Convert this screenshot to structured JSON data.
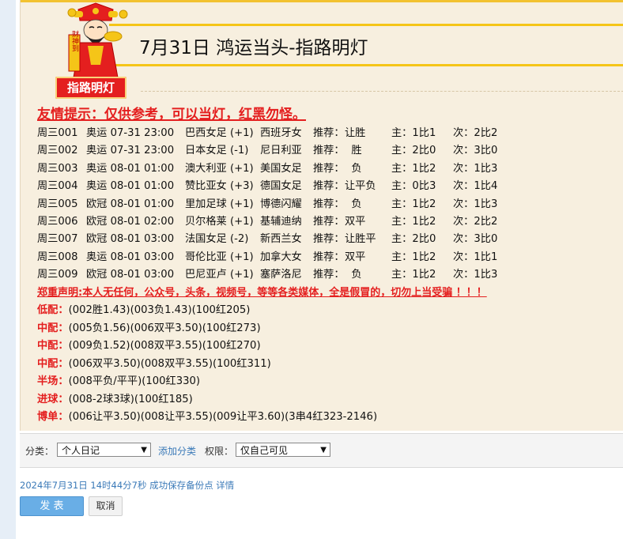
{
  "post": {
    "title": "7月31日 鸿运当头-指路明灯",
    "banner": "指路明灯",
    "mascot_label": "财神到",
    "tip": "友情提示：仅供参考，可以当灯，红黑勿怪。",
    "matches": [
      {
        "code": "周三001",
        "league_time": "奥运 07-31 23:00",
        "home": "巴西女足 (+1)",
        "away": "西班牙女",
        "rec_label": "推荐：",
        "rec": "让胜",
        "main": "主：1比1",
        "sub": "次：2比2"
      },
      {
        "code": "周三002",
        "league_time": "奥运 07-31 23:00",
        "home": "日本女足 (-1)",
        "away": "尼日利亚",
        "rec_label": "推荐：",
        "rec": "  胜",
        "main": "主：2比0",
        "sub": "次：3比0"
      },
      {
        "code": "周三003",
        "league_time": "奥运 08-01 01:00",
        "home": "澳大利亚 (+1)",
        "away": "美国女足",
        "rec_label": "推荐：",
        "rec": "  负",
        "main": "主：1比2",
        "sub": "次：1比3"
      },
      {
        "code": "周三004",
        "league_time": "奥运 08-01 01:00",
        "home": "赞比亚女 (+3)",
        "away": "德国女足",
        "rec_label": "推荐：",
        "rec": "让平负",
        "main": "主：0比3",
        "sub": "次：1比4"
      },
      {
        "code": "周三005",
        "league_time": "欧冠 08-01 01:00",
        "home": "里加足球 (+1)",
        "away": "博德闪耀",
        "rec_label": "推荐：",
        "rec": "  负",
        "main": "主：1比2",
        "sub": "次：1比3"
      },
      {
        "code": "周三006",
        "league_time": "欧冠 08-01 02:00",
        "home": "贝尔格莱 (+1)",
        "away": "基辅迪纳",
        "rec_label": "推荐：",
        "rec": "双平",
        "main": "主：1比2",
        "sub": "次：2比2"
      },
      {
        "code": "周三007",
        "league_time": "欧冠 08-01 03:00",
        "home": "法国女足 (-2)",
        "away": "新西兰女",
        "rec_label": "推荐：",
        "rec": "让胜平",
        "main": "主：2比0",
        "sub": "次：3比0"
      },
      {
        "code": "周三008",
        "league_time": "奥运 08-01 03:00",
        "home": "哥伦比亚 (+1)",
        "away": "加拿大女",
        "rec_label": "推荐：",
        "rec": "双平",
        "main": "主：1比2",
        "sub": "次：1比1"
      },
      {
        "code": "周三009",
        "league_time": "欧冠 08-01 03:00",
        "home": "巴尼亚卢 (+1)",
        "away": "塞萨洛尼",
        "rec_label": "推荐：",
        "rec": "  负",
        "main": "主：1比2",
        "sub": "次：1比3"
      }
    ],
    "warning": "郑重声明:本人无任何，公众号，头条，视频号，等等各类媒体，全是假冒的，切勿上当受骗 ！！！",
    "combos": [
      {
        "label": "低配：",
        "value": "(002胜1.43)(003负1.43)(100红205)"
      },
      {
        "label": "中配：",
        "value": "(005负1.56)(006双平3.50)(100红273)"
      },
      {
        "label": "中配：",
        "value": "(009负1.52)(008双平3.55)(100红270)"
      },
      {
        "label": "中配：",
        "value": "(006双平3.50)(008双平3.55)(100红311)"
      },
      {
        "label": "半场：",
        "value": "(008平负/平平)(100红330)"
      },
      {
        "label": "进球：",
        "value": "(008-2球3球)(100红185)"
      },
      {
        "label": "博单：",
        "value": "(006让平3.50)(008让平3.55)(009让平3.60)(3串4红323-2146)"
      }
    ]
  },
  "toolbar": {
    "category_label": "分类：",
    "category_value": "个人日记",
    "add_category": "添加分类",
    "permission_label": "权限：",
    "permission_value": "仅自己可见"
  },
  "status": {
    "saved_text": "2024年7月31日 14时44分7秒 成功保存备份点",
    "details_link": "详情"
  },
  "actions": {
    "publish": "发 表",
    "cancel": "取消"
  },
  "colors": {
    "accent_red": "#e41f1f",
    "title_border": "#f5c518",
    "paper": "#f7efdf",
    "link": "#3b7ab8",
    "primary_button": "#69aee6"
  }
}
